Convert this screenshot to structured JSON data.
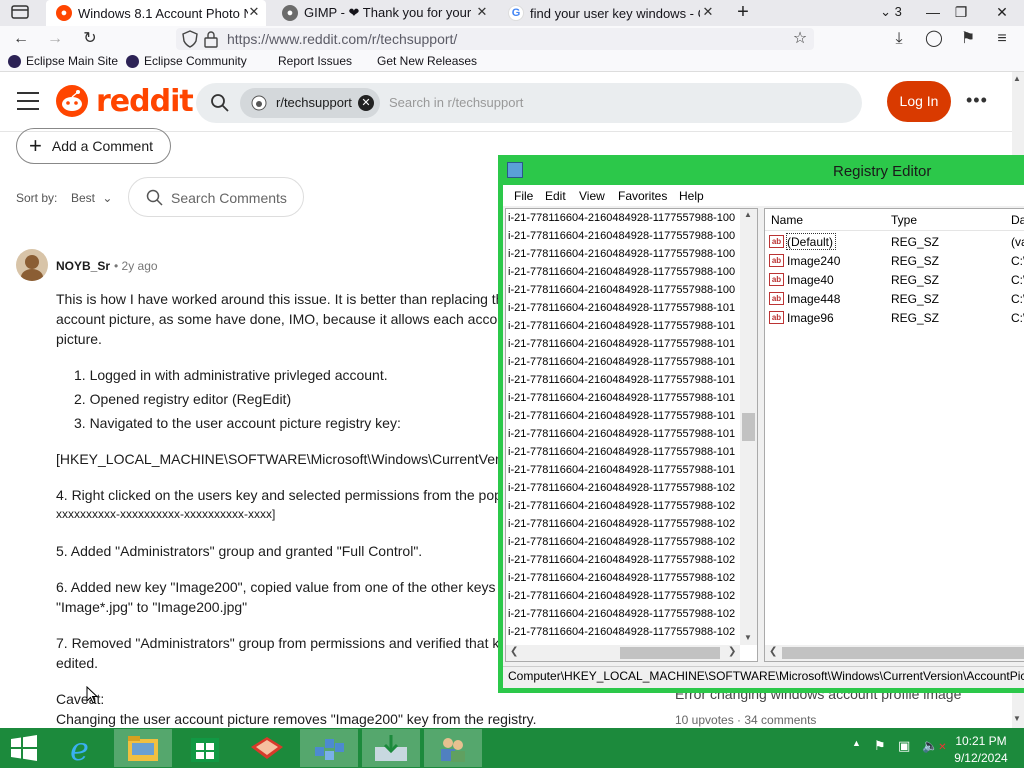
{
  "browser": {
    "tabs": [
      {
        "title": "Windows 8.1 Account Photo Nc",
        "active": true
      },
      {
        "title": "GIMP - ❤ Thank you for your su",
        "active": false
      },
      {
        "title": "find your user key windows - Go",
        "active": false
      }
    ],
    "tab_count": "3",
    "url": "https://www.reddit.com/r/techsupport/",
    "bookmarks": [
      "Eclipse Main Site",
      "Eclipse Community",
      "Report Issues",
      "Get New Releases"
    ]
  },
  "reddit": {
    "logo_text": "reddit",
    "search_chip": "r/techsupport",
    "search_placeholder": "Search in r/techsupport",
    "login_label": "Log In",
    "add_comment_label": "Add a Comment",
    "sort_label": "Sort by:",
    "sort_value": "Best",
    "search_comments_label": "Search Comments",
    "comment": {
      "username": "NOYB_Sr",
      "time": "• 2y ago",
      "lines": [
        "This is how I have worked around this issue. It is better than replacing th",
        "account picture, as some have done, IMO, because it allows each accoun",
        "picture."
      ],
      "list": [
        "1. Logged in with administrative privleged account.",
        "2. Opened registry editor (RegEdit)",
        "3. Navigated to the user account picture registry key:"
      ],
      "paragraphs": [
        "[HKEY_LOCAL_MACHINE\\SOFTWARE\\Microsoft\\Windows\\CurrentVersion",
        "4. Right clicked on the users key and selected permissions from the popu",
        "xxxxxxxxxx-xxxxxxxxxx-xxxxxxxxxx-xxxx]",
        "5. Added \"Administrators\" group and granted \"Full Control\".",
        "6. Added new key \"Image200\", copied value from one of the other keys a",
        "\"Image*.jpg\" to \"Image200.jpg\"",
        "7. Removed \"Administrators\" group from permissions and verified that k",
        "edited.",
        "Caveat:",
        "Changing the user account picture removes \"Image200\" key from the registry."
      ]
    },
    "related": {
      "title": "Error changing windows account profile image",
      "stats": "10 upvotes · 34 comments"
    }
  },
  "registry": {
    "title": "Registry Editor",
    "menu": [
      "File",
      "Edit",
      "View",
      "Favorites",
      "Help"
    ],
    "tree_rows": [
      "i-21-778116604-2160484928-1177557988-100",
      "i-21-778116604-2160484928-1177557988-100",
      "i-21-778116604-2160484928-1177557988-100",
      "i-21-778116604-2160484928-1177557988-100",
      "i-21-778116604-2160484928-1177557988-100",
      "i-21-778116604-2160484928-1177557988-101",
      "i-21-778116604-2160484928-1177557988-101",
      "i-21-778116604-2160484928-1177557988-101",
      "i-21-778116604-2160484928-1177557988-101",
      "i-21-778116604-2160484928-1177557988-101",
      "i-21-778116604-2160484928-1177557988-101",
      "i-21-778116604-2160484928-1177557988-101",
      "i-21-778116604-2160484928-1177557988-101",
      "i-21-778116604-2160484928-1177557988-101",
      "i-21-778116604-2160484928-1177557988-101",
      "i-21-778116604-2160484928-1177557988-102",
      "i-21-778116604-2160484928-1177557988-102",
      "i-21-778116604-2160484928-1177557988-102",
      "i-21-778116604-2160484928-1177557988-102",
      "i-21-778116604-2160484928-1177557988-102",
      "i-21-778116604-2160484928-1177557988-102",
      "i-21-778116604-2160484928-1177557988-102",
      "i-21-778116604-2160484928-1177557988-102",
      "i-21-778116604-2160484928-1177557988-102",
      "i-21-778116604-2160484928-1177557988-102"
    ],
    "columns": [
      "Name",
      "Type",
      "Da"
    ],
    "values": [
      {
        "name": "(Default)",
        "type": "REG_SZ",
        "data": "(va"
      },
      {
        "name": "Image240",
        "type": "REG_SZ",
        "data": "C:\\"
      },
      {
        "name": "Image40",
        "type": "REG_SZ",
        "data": "C:\\"
      },
      {
        "name": "Image448",
        "type": "REG_SZ",
        "data": "C:\\"
      },
      {
        "name": "Image96",
        "type": "REG_SZ",
        "data": "C:\\"
      }
    ],
    "status_path": "Computer\\HKEY_LOCAL_MACHINE\\SOFTWARE\\Microsoft\\Windows\\CurrentVersion\\AccountPict"
  },
  "taskbar": {
    "time": "10:21 PM",
    "date": "9/12/2024"
  },
  "colors": {
    "reddit_orange": "#ff4500",
    "login_button": "#d93a00",
    "regedit_frame": "#2cc84a",
    "taskbar": "#1c8a3c"
  }
}
